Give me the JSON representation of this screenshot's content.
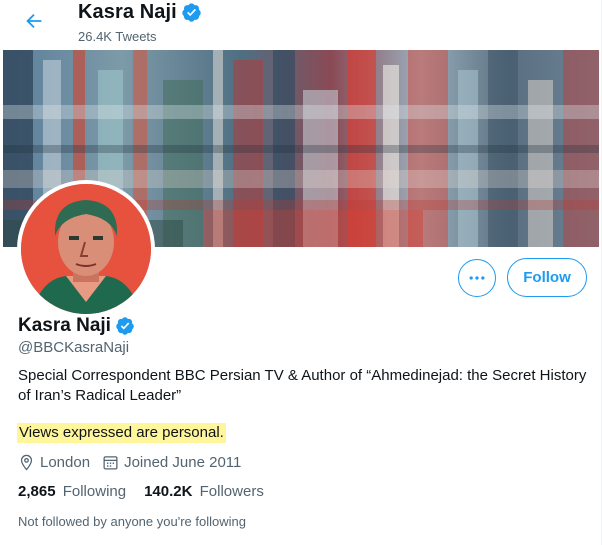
{
  "header": {
    "title": "Kasra Naji",
    "tweet_count": "26.4K Tweets"
  },
  "actions": {
    "follow_label": "Follow"
  },
  "profile": {
    "name": "Kasra Naji",
    "handle": "@BBCKasraNaji",
    "bio_line1": "Special Correspondent BBC Persian TV & Author of “Ahmedinejad: the Secret History",
    "bio_line2": "of Iran’s Radical Leader”",
    "highlight": "Views expressed are personal.",
    "location": "London",
    "joined": "Joined June 2011"
  },
  "stats": {
    "following_count": "2,865",
    "following_label": "Following",
    "followers_count": "140.2K",
    "followers_label": "Followers"
  },
  "note": "Not followed by anyone you're following",
  "colors": {
    "accent": "#1d9bf0",
    "highlight": "#fff59a",
    "avatar_bg": "#e7523f"
  },
  "icons": {
    "back": "arrow-left-icon",
    "verified": "verified-badge-icon",
    "more": "more-horizontal-icon",
    "location": "location-pin-icon",
    "calendar": "calendar-icon"
  }
}
